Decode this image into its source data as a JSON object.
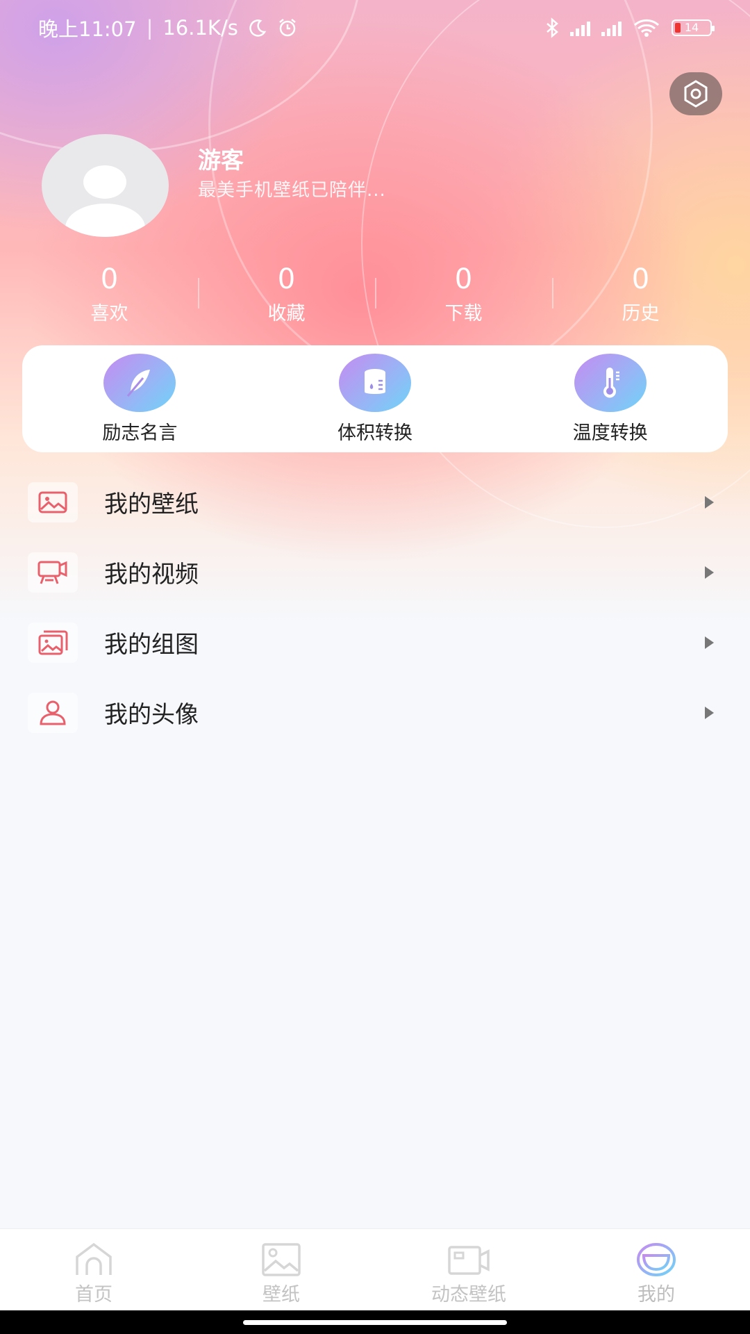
{
  "status_bar": {
    "time": "晚上11:07",
    "speed": "16.1K/s",
    "battery": "14",
    "icons": [
      "moon-icon",
      "alarm-icon",
      "bluetooth-icon",
      "signal-icon",
      "wifi-icon",
      "battery-icon"
    ]
  },
  "profile": {
    "name": "游客",
    "bio": "最美手机壁纸已陪伴..."
  },
  "stats": [
    {
      "value": "0",
      "label": "喜欢"
    },
    {
      "value": "0",
      "label": "收藏"
    },
    {
      "value": "0",
      "label": "下载"
    },
    {
      "value": "0",
      "label": "历史"
    }
  ],
  "tools": [
    {
      "label": "励志名言",
      "icon": "feather-icon"
    },
    {
      "label": "体积转换",
      "icon": "volume-icon"
    },
    {
      "label": "温度转换",
      "icon": "thermometer-icon"
    }
  ],
  "menu": [
    {
      "label": "我的壁纸",
      "icon": "image-icon"
    },
    {
      "label": "我的视频",
      "icon": "video-icon"
    },
    {
      "label": "我的组图",
      "icon": "gallery-icon"
    },
    {
      "label": "我的头像",
      "icon": "user-icon"
    }
  ],
  "tabbar": [
    {
      "label": "首页",
      "icon": "home-icon"
    },
    {
      "label": "壁纸",
      "icon": "picture-icon"
    },
    {
      "label": "动态壁纸",
      "icon": "camera-icon"
    },
    {
      "label": "我的",
      "icon": "smile-icon"
    }
  ],
  "colors": {
    "accent": "#e8606b",
    "tool_gradient_start": "#c58bf1",
    "tool_gradient_end": "#6ed4f8"
  }
}
